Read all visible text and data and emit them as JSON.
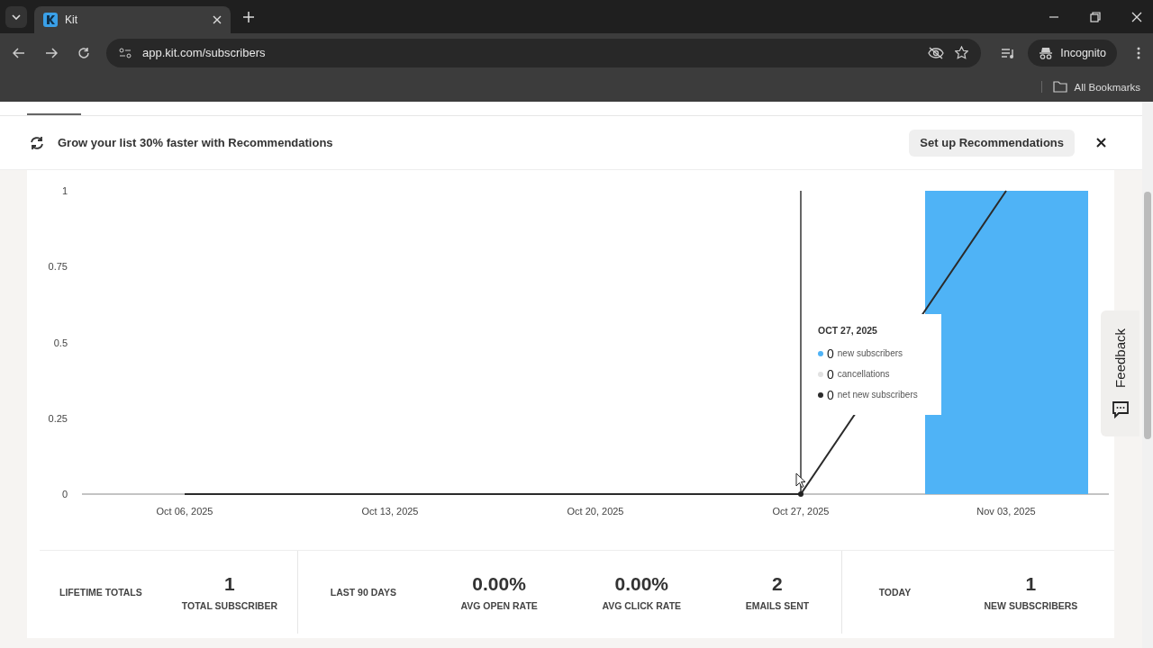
{
  "browser": {
    "tab_title": "Kit",
    "url": "app.kit.com/subscribers",
    "profile": "Incognito",
    "bookmarks": "All Bookmarks"
  },
  "banner": {
    "text": "Grow your list 30% faster with Recommendations",
    "button": "Set up Recommendations"
  },
  "chart": {
    "chart_data": {
      "type": "bar",
      "categories": [
        "Oct 06, 2025",
        "Oct 13, 2025",
        "Oct 20, 2025",
        "Oct 27, 2025",
        "Nov 03, 2025"
      ],
      "ylim": [
        0,
        1
      ],
      "yticks": [
        0,
        0.25,
        0.5,
        0.75,
        1
      ],
      "values": [
        0,
        0,
        0,
        0,
        1
      ]
    },
    "tooltip": {
      "title": "OCT 27, 2025",
      "rows": [
        {
          "value": "0",
          "label": "new subscribers",
          "color": "#4fb3f6"
        },
        {
          "value": "0",
          "label": "cancellations",
          "color": "#e2e2e2"
        },
        {
          "value": "0",
          "label": "net new subscribers",
          "color": "#2b2b2b"
        }
      ]
    }
  },
  "feedback": "Feedback",
  "stats": [
    {
      "heading": "LIFETIME TOTALS",
      "items": [
        {
          "value": "1",
          "label": "TOTAL SUBSCRIBER"
        }
      ]
    },
    {
      "heading": "LAST 90 DAYS",
      "items": [
        {
          "value": "0.00%",
          "label": "AVG OPEN RATE"
        },
        {
          "value": "0.00%",
          "label": "AVG CLICK RATE"
        },
        {
          "value": "2",
          "label": "EMAILS SENT"
        }
      ]
    },
    {
      "heading": "TODAY",
      "items": [
        {
          "value": "1",
          "label": "NEW SUBSCRIBERS"
        }
      ]
    }
  ]
}
